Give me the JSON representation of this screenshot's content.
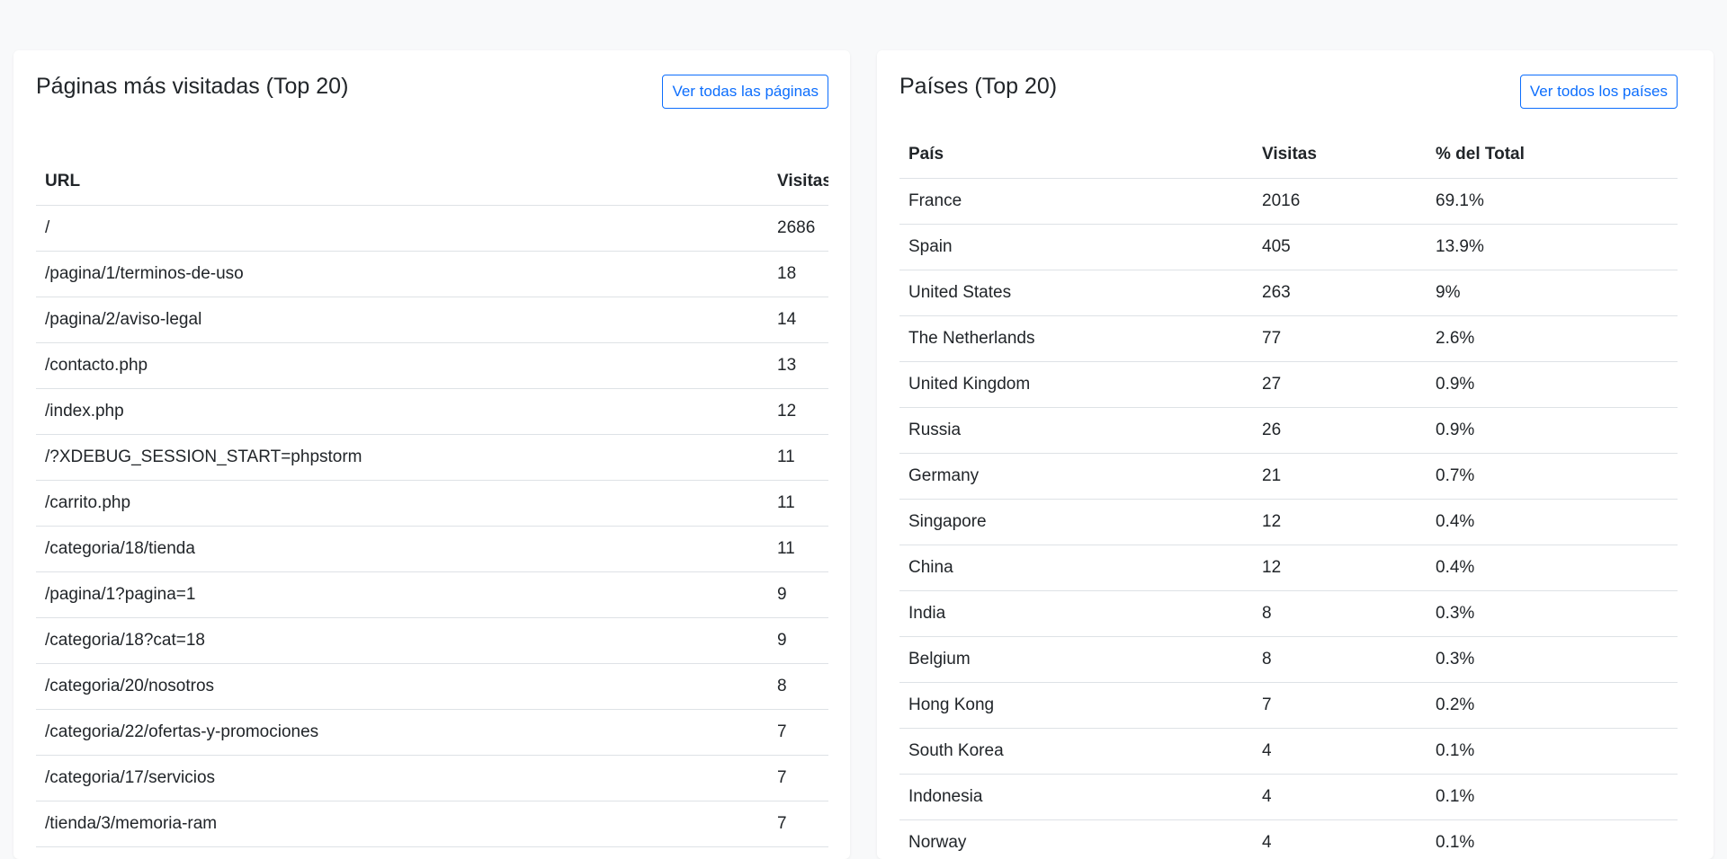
{
  "pages_card": {
    "title": "Páginas más visitadas (Top 20)",
    "button_label": "Ver todas las páginas",
    "columns": [
      "URL",
      "Visitas"
    ],
    "rows": [
      {
        "url": "/",
        "visits": "2686"
      },
      {
        "url": "/pagina/1/terminos-de-uso",
        "visits": "18"
      },
      {
        "url": "/pagina/2/aviso-legal",
        "visits": "14"
      },
      {
        "url": "/contacto.php",
        "visits": "13"
      },
      {
        "url": "/index.php",
        "visits": "12"
      },
      {
        "url": "/?XDEBUG_SESSION_START=phpstorm",
        "visits": "11"
      },
      {
        "url": "/carrito.php",
        "visits": "11"
      },
      {
        "url": "/categoria/18/tienda",
        "visits": "11"
      },
      {
        "url": "/pagina/1?pagina=1",
        "visits": "9"
      },
      {
        "url": "/categoria/18?cat=18",
        "visits": "9"
      },
      {
        "url": "/categoria/20/nosotros",
        "visits": "8"
      },
      {
        "url": "/categoria/22/ofertas-y-promociones",
        "visits": "7"
      },
      {
        "url": "/categoria/17/servicios",
        "visits": "7"
      },
      {
        "url": "/tienda/3/memoria-ram",
        "visits": "7"
      }
    ]
  },
  "countries_card": {
    "title": "Países (Top 20)",
    "button_label": "Ver todos los países",
    "columns": [
      "País",
      "Visitas",
      "% del Total"
    ],
    "rows": [
      {
        "country": "France",
        "visits": "2016",
        "pct": "69.1%"
      },
      {
        "country": "Spain",
        "visits": "405",
        "pct": "13.9%"
      },
      {
        "country": "United States",
        "visits": "263",
        "pct": "9%"
      },
      {
        "country": "The Netherlands",
        "visits": "77",
        "pct": "2.6%"
      },
      {
        "country": "United Kingdom",
        "visits": "27",
        "pct": "0.9%"
      },
      {
        "country": "Russia",
        "visits": "26",
        "pct": "0.9%"
      },
      {
        "country": "Germany",
        "visits": "21",
        "pct": "0.7%"
      },
      {
        "country": "Singapore",
        "visits": "12",
        "pct": "0.4%"
      },
      {
        "country": "China",
        "visits": "12",
        "pct": "0.4%"
      },
      {
        "country": "India",
        "visits": "8",
        "pct": "0.3%"
      },
      {
        "country": "Belgium",
        "visits": "8",
        "pct": "0.3%"
      },
      {
        "country": "Hong Kong",
        "visits": "7",
        "pct": "0.2%"
      },
      {
        "country": "South Korea",
        "visits": "4",
        "pct": "0.1%"
      },
      {
        "country": "Indonesia",
        "visits": "4",
        "pct": "0.1%"
      },
      {
        "country": "Norway",
        "visits": "4",
        "pct": "0.1%"
      }
    ]
  },
  "colors": {
    "accent": "#0d6efd",
    "background": "#f8f9fa",
    "card": "#ffffff",
    "border": "#dee2e6",
    "text": "#212529"
  }
}
